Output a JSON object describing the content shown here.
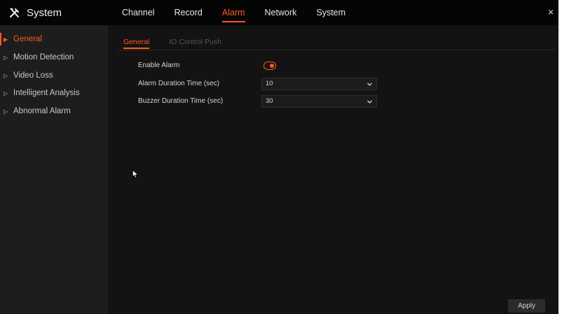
{
  "app": {
    "title": "System",
    "icon": "tools-icon",
    "close_symbol": "×"
  },
  "nav": {
    "tabs": [
      {
        "label": "Channel",
        "active": false
      },
      {
        "label": "Record",
        "active": false
      },
      {
        "label": "Alarm",
        "active": true
      },
      {
        "label": "Network",
        "active": false
      },
      {
        "label": "System",
        "active": false
      }
    ]
  },
  "sidebar": {
    "items": [
      {
        "label": "General",
        "active": true
      },
      {
        "label": "Motion Detection",
        "active": false
      },
      {
        "label": "Video Loss",
        "active": false
      },
      {
        "label": "Intelligent Analysis",
        "active": false
      },
      {
        "label": "Abnormal Alarm",
        "active": false
      }
    ],
    "active_marker": "▶",
    "inactive_marker": "▷"
  },
  "subtabs": [
    {
      "label": "General",
      "active": true
    },
    {
      "label": "IO Control Push",
      "active": false
    }
  ],
  "form": {
    "enable_alarm": {
      "label": "Enable Alarm",
      "enabled": true
    },
    "alarm_duration": {
      "label": "Alarm Duration Time (sec)",
      "value": "10"
    },
    "buzzer_duration": {
      "label": "Buzzer Duration Time (sec)",
      "value": "30"
    }
  },
  "footer": {
    "apply_label": "Apply"
  },
  "colors": {
    "accent": "#ff5a1f",
    "background": "#131313",
    "sidebar": "#1d1d1d",
    "topbar": "#050505"
  }
}
